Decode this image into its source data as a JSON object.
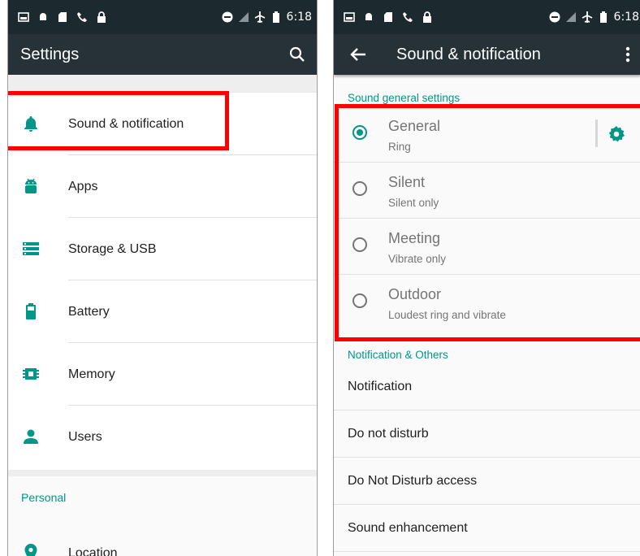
{
  "left": {
    "statusbar": {
      "time": "6:18"
    },
    "toolbar": {
      "title": "Settings",
      "search_icon": "search-icon"
    },
    "items": [
      {
        "label": "Sound & notification",
        "icon": "bell-icon"
      },
      {
        "label": "Apps",
        "icon": "android-icon"
      },
      {
        "label": "Storage & USB",
        "icon": "storage-icon"
      },
      {
        "label": "Battery",
        "icon": "battery-icon"
      },
      {
        "label": "Memory",
        "icon": "memory-icon"
      },
      {
        "label": "Users",
        "icon": "person-icon"
      }
    ],
    "personal": {
      "header": "Personal",
      "items": [
        {
          "label": "Location",
          "icon": "location-pin-icon"
        }
      ]
    }
  },
  "right": {
    "statusbar": {
      "time": "6:18"
    },
    "toolbar": {
      "title": "Sound & notification",
      "back_icon": "arrow-back-icon",
      "menu_icon": "more-vert-icon"
    },
    "sound_section": {
      "header": "Sound general settings",
      "profiles": [
        {
          "title": "General",
          "subtitle": "Ring",
          "selected": true
        },
        {
          "title": "Silent",
          "subtitle": "Silent only",
          "selected": false
        },
        {
          "title": "Meeting",
          "subtitle": "Vibrate only",
          "selected": false
        },
        {
          "title": "Outdoor",
          "subtitle": "Loudest ring and vibrate",
          "selected": false
        }
      ]
    },
    "notification_section": {
      "header": "Notification & Others",
      "items": [
        {
          "label": "Notification"
        },
        {
          "label": "Do not disturb"
        },
        {
          "label": "Do Not Disturb access"
        },
        {
          "label": "Sound enhancement"
        }
      ]
    }
  },
  "colors": {
    "accent": "#009688",
    "statusbar": "#1c2a30",
    "toolbar": "#263238",
    "highlight": "#ff0000"
  }
}
